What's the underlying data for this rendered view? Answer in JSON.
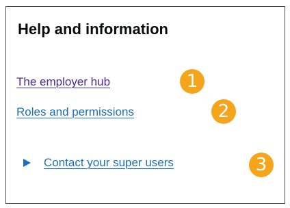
{
  "panel": {
    "heading": "Help and information",
    "links": [
      {
        "label": "The employer hub",
        "state": "visited",
        "color": "#4c2c92"
      },
      {
        "label": "Roles and permissions",
        "state": "unvisited",
        "color": "#1d70b8"
      }
    ],
    "details": {
      "summary": "Contact your super users",
      "expanded": false,
      "icon": "triangle-right-icon"
    }
  },
  "callouts": [
    "1",
    "2",
    "3"
  ],
  "colors": {
    "link": "#1d70b8",
    "link_visited": "#4c2c92",
    "callout": "#f4a51c",
    "text": "#0b0c0c",
    "border": "#4a4a4a"
  }
}
